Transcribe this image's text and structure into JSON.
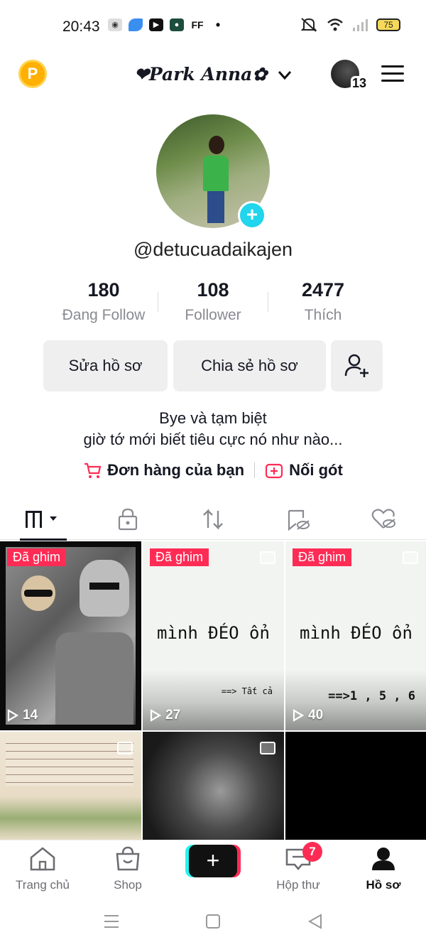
{
  "status_bar": {
    "time": "20:43",
    "battery": "75",
    "notif_icons": [
      "gamepad-icon",
      "cloud-app-icon",
      "youtube-icon",
      "app-icon",
      "ff-label"
    ],
    "ff_text": "FF",
    "dot": "•"
  },
  "header": {
    "coins_label": "P",
    "title": "❤Park Anna✿",
    "inbox_count": "13"
  },
  "profile": {
    "handle": "@detucuadaikajen",
    "stats": [
      {
        "value": "180",
        "label": "Đang Follow"
      },
      {
        "value": "108",
        "label": "Follower"
      },
      {
        "value": "2477",
        "label": "Thích"
      }
    ],
    "edit_button": "Sửa hồ sơ",
    "share_button": "Chia sẻ hồ sơ",
    "bio_line1": "Bye và tạm biệt",
    "bio_line2": "giờ tớ mới biết tiêu cực nó như nào...",
    "link_orders": "Đơn hàng của bạn",
    "link_fanclub": "Nối gót"
  },
  "tabs": [
    "videos-tab",
    "private-tab",
    "reposts-tab",
    "favorites-tab",
    "liked-tab"
  ],
  "grid": {
    "pinned_label": "Đã ghim",
    "tiles": [
      {
        "views": "14",
        "pinned": true
      },
      {
        "views": "27",
        "pinned": true,
        "text": "mình ĐÉO ổn",
        "sub": "==> Tất cả"
      },
      {
        "views": "40",
        "pinned": true,
        "text": "mình ĐÉO ổn",
        "sub": "==>1 , 5 , 6"
      },
      {
        "views": ""
      },
      {
        "views": ""
      },
      {
        "views": ""
      }
    ]
  },
  "bottom_nav": {
    "home": "Trang chủ",
    "shop": "Shop",
    "inbox": "Hộp thư",
    "inbox_badge": "7",
    "profile": "Hồ sơ",
    "create": "+"
  },
  "colors": {
    "accent_red": "#fe2c55",
    "accent_cyan": "#25f4ee",
    "coin": "#ffb000"
  }
}
